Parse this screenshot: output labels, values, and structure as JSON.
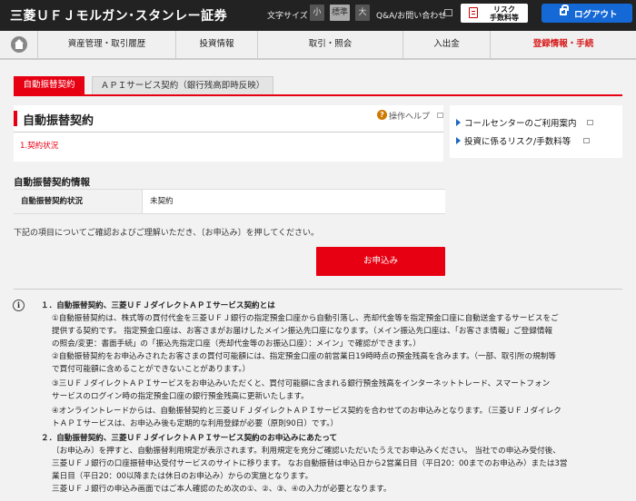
{
  "header": {
    "logo": "三菱ＵＦＪモルガン･スタンレー証券",
    "font_size_label": "文字サイズ",
    "font_sizes": [
      "小",
      "標準",
      "大"
    ],
    "faq": "Q&A/お問い合わせ",
    "risk_button": "リスク\n手数料等",
    "logout": "ログアウト"
  },
  "nav": {
    "home_icon": "home-icon",
    "items": [
      "資産管理・取引履歴",
      "投資情報",
      "取引・照会",
      "入出金",
      "登録情報・手続"
    ]
  },
  "tabs": [
    "自動振替契約",
    "ＡＰＩサービス契約（銀行残高即時反映）"
  ],
  "main": {
    "title": "自動振替契約",
    "step": "1.契約状況",
    "help": "操作ヘルプ"
  },
  "side_links": [
    "コールセンターのご利用案内",
    "投資に係るリスク/手数料等"
  ],
  "contract_info": {
    "section_title": "自動振替契約情報",
    "row_label": "自動振替契約状況",
    "row_value": "未契約"
  },
  "notice": "下記の項目についてご確認およびご理解いただき、〔お申込み〕を押してください。",
  "apply_button": "お申込み",
  "info_lines": [
    "１．自動振替契約、三菱ＵＦＪダイレクトＡＰＩサービス契約とは",
    "①自動振替契約は、株式等の買付代金を三菱ＵＦＪ銀行の指定預金口座から自動引落し、売却代金等を指定預金口座に自動送金するサービスをご",
    "提供する契約です。 指定預金口座は、お客さまがお届けしたメイン振込先口座になります。（メイン振込先口座は、「お客さま情報」ご登録情報",
    "の照会/変更：書面手続」の「振込先指定口座（売却代金等のお振込口座）：メイン」で確認ができます。）",
    "②自動振替契約をお申込みされたお客さまの買付可能額には、指定預金口座の前営業日19時時点の預金残高を含みます。（一部、取引所の規制等",
    "で買付可能額に含めることができないことがあります。）",
    "③三ＵＦＪダイレクトＡＰＩサービスをお申込みいただくと、買付可能額に含まれる銀行預金残高をインターネットトレード、スマートフォン",
    "サービスのログイン時の指定預金口座の銀行預金残高に更新いたします。",
    "④オンライントレードからは、自動振替契約と三菱ＵＦＪダイレクトＡＰＩサービス契約を合わせてのお申込みとなります。（三菱ＵＦＪダイレク",
    "トＡＰＩサービスは、お申込み後も定期的な利用登録が必要（原則90日）です。）",
    "２．自動振替契約、三菱ＵＦＪダイレクトＡＰＩサービス契約のお申込みにあたって",
    "〔お申込み〕を押すと、自動振替利用規定が表示されます。利用規定を充分ご確認いただいたうえでお申込みください。 当社での申込み受付後、",
    "三菱ＵＦＪ銀行の口座振替申込受付サービスのサイトに移ります。 なお自動振替は申込日から2営業日目（平日20：00までのお申込み）または3営",
    "業日目（平日20：00以降または休日のお申込み）からの実施となります。",
    "三菱ＵＦＪ銀行の申込み画面ではご本人確認のため次の①、②、③、④の入力が必要となります。"
  ]
}
